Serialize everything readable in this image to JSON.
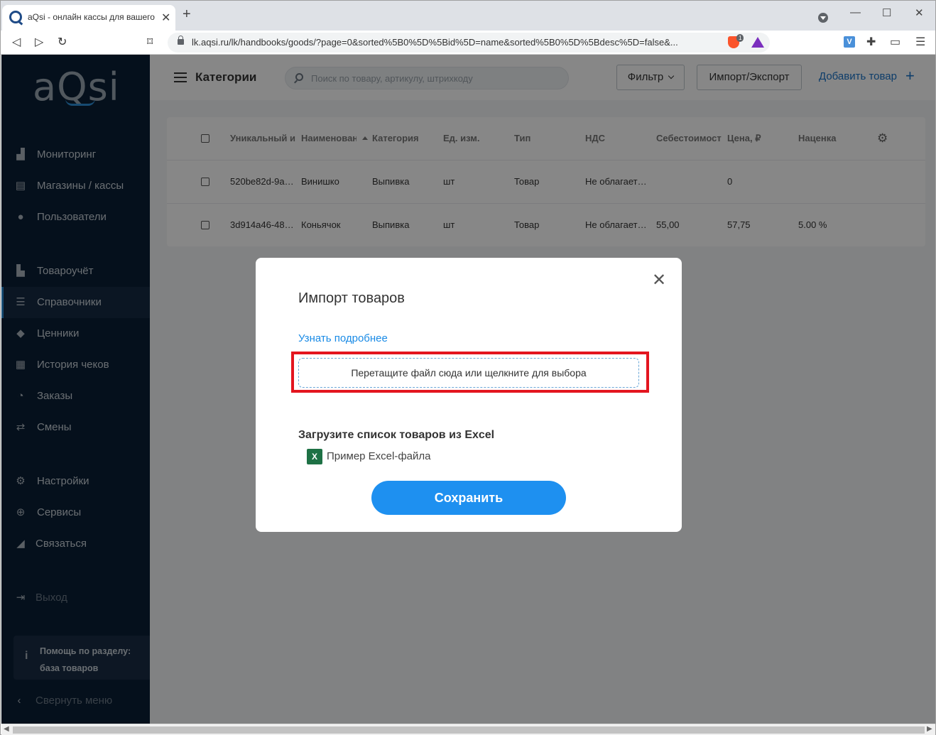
{
  "browser": {
    "tab_title": "aQsi - онлайн кассы для вашего бизнеса",
    "url": "lk.aqsi.ru/lk/handbooks/goods/?page=0&sorted%5B0%5D%5Bid%5D=name&sorted%5B0%5D%5Bdesc%5D=false&...",
    "badge_count": "1",
    "ext_v_label": "V"
  },
  "sidebar": {
    "logo": "aQsi",
    "items": [
      {
        "label": "Мониторинг",
        "icon": "bar-chart-icon"
      },
      {
        "label": "Магазины / кассы",
        "icon": "store-icon"
      },
      {
        "label": "Пользователи",
        "icon": "user-icon"
      },
      {
        "label": "Товароучёт",
        "icon": "boxes-icon"
      },
      {
        "label": "Справочники",
        "icon": "list-icon"
      },
      {
        "label": "Ценники",
        "icon": "tag-icon"
      },
      {
        "label": "История чеков",
        "icon": "receipt-icon"
      },
      {
        "label": "Заказы",
        "icon": "clock-icon"
      },
      {
        "label": "Смены",
        "icon": "swap-icon"
      },
      {
        "label": "Настройки",
        "icon": "gear-icon"
      },
      {
        "label": "Сервисы",
        "icon": "plus-circle-icon"
      },
      {
        "label": "Связаться",
        "icon": "megaphone-icon"
      },
      {
        "label": "Выход",
        "icon": "logout-icon"
      }
    ],
    "help_line1": "Помощь по разделу:",
    "help_line2": "база товаров",
    "collapse_label": "Свернуть меню"
  },
  "topbar": {
    "categories_label": "Категории",
    "search_placeholder": "Поиск по товару, артикулу, штрихкоду",
    "filter_label": "Фильтр",
    "import_export_label": "Импорт/Экспорт",
    "add_goods_label": "Добавить товар"
  },
  "table": {
    "columns": [
      "Уникальный и",
      "Наименован",
      "Категория",
      "Ед. изм.",
      "Тип",
      "НДС",
      "Себестоимост",
      "Цена, ₽",
      "Наценка"
    ],
    "rows": [
      [
        "520be82d-9a…",
        "Винишко",
        "Выпивка",
        "шт",
        "Товар",
        "Не облагает…",
        "",
        "0",
        ""
      ],
      [
        "3d914a46-48…",
        "Коньячок",
        "Выпивка",
        "шт",
        "Товар",
        "Не облагает…",
        "55,00",
        "57,75",
        "5.00 %"
      ]
    ]
  },
  "modal": {
    "title": "Импорт товаров",
    "learn_more": "Узнать подробнее",
    "drop_zone": "Перетащите файл сюда или щелкните для выбора",
    "excel_title": "Загрузите список товаров из Excel",
    "excel_icon_label": "X",
    "excel_link": "Пример Excel-файла",
    "save_label": "Сохранить"
  },
  "colors": {
    "sidebar_bg": "#0b1f35",
    "accent": "#1e90f0",
    "highlight": "#e3151f"
  }
}
